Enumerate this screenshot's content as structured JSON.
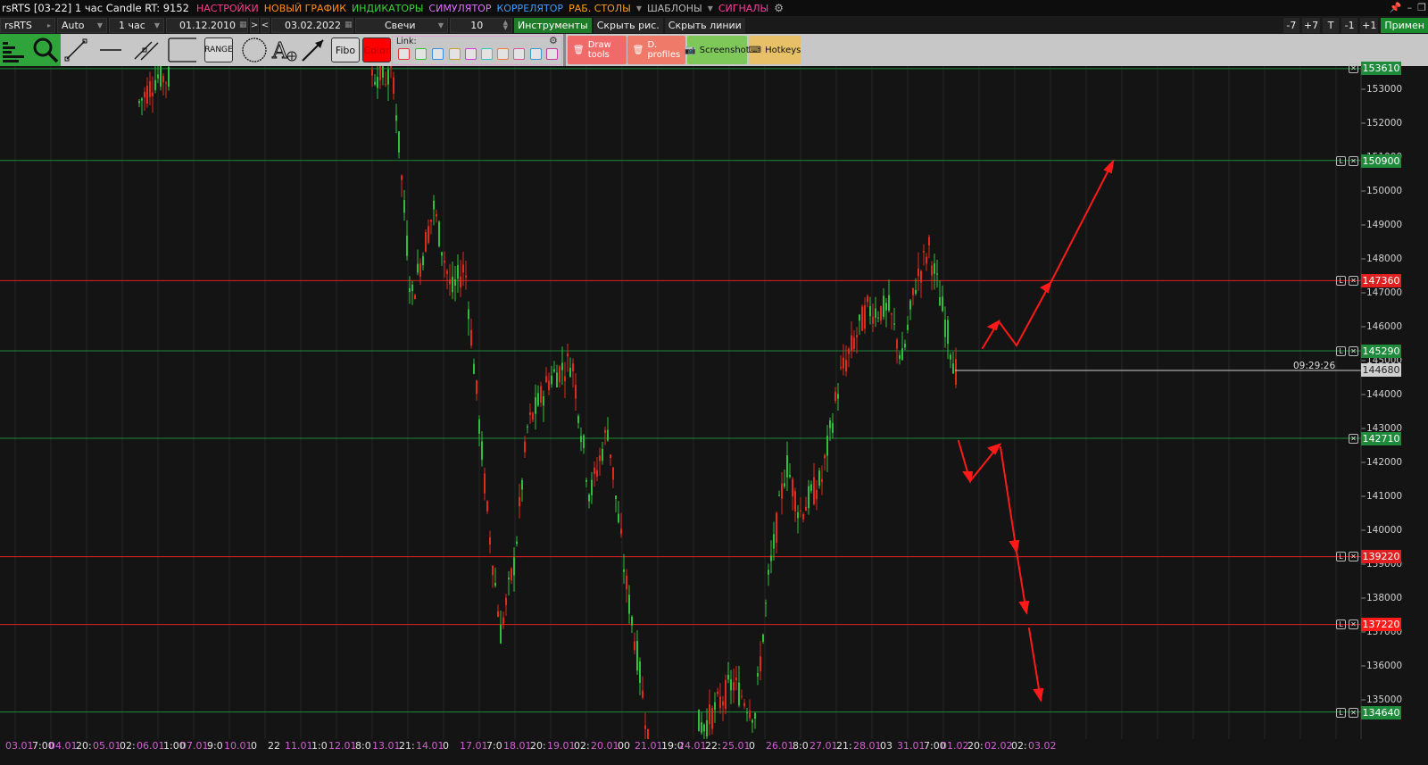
{
  "menu": {
    "title": "rsRTS [03-22] 1 час Candle RT: 9152",
    "items": [
      {
        "label": "НАСТРОЙКИ",
        "color": "#ff3c8c"
      },
      {
        "label": "НОВЫЙ ГРАФИК",
        "color": "#ff8c1a"
      },
      {
        "label": "ИНДИКАТОРЫ",
        "color": "#3cd23c"
      },
      {
        "label": "СИМУЛЯТОР",
        "color": "#e070ff"
      },
      {
        "label": "КОРРЕЛЯТОР",
        "color": "#3c9cff"
      },
      {
        "label": "РАБ. СТОЛЫ",
        "color": "#ff9c1a"
      },
      {
        "label": "ШАБЛОНЫ",
        "color": "#b9b9b9"
      },
      {
        "label": "СИГНАЛЫ",
        "color": "#ff3ca0"
      }
    ]
  },
  "toolbar": {
    "symbol": "rsRTS",
    "mode": "Auto",
    "timeframe": "1 час",
    "date_from": "01.12.2010",
    "nav_next": ">",
    "nav_prev": "<",
    "date_to": "03.02.2022",
    "chart_type": "Свечи",
    "count": "10",
    "instruments": "Инструменты",
    "hide_drawings": "Скрыть рис.",
    "hide_lines": "Скрыть линии",
    "right_buttons": [
      "-7",
      "+7",
      "T",
      "-1",
      "+1"
    ],
    "apply": "Примен"
  },
  "drawbar": {
    "range_label": "RANGE",
    "fibo_label": "Fibo",
    "color_label": "Color",
    "link_label": "Link:",
    "link_colors": [
      "#e23b3b",
      "#39c23c",
      "#3b8fe0",
      "#c89a2f",
      "#d23bd2",
      "#2fc9c9",
      "#f27b3a",
      "#e64da0",
      "#3a9ac9",
      "#c23ba0"
    ],
    "draw_tools": "Draw tools",
    "profiles": "D. profiles",
    "screenshot": "Screenshot",
    "hotkeys": "Hotkeys"
  },
  "price_axis": {
    "ticks": [
      "153000",
      "152000",
      "151000",
      "150000",
      "149000",
      "148000",
      "147000",
      "146000",
      "145000",
      "144000",
      "143000",
      "142000",
      "141000",
      "140000",
      "139000",
      "138000",
      "137000",
      "136000",
      "135000"
    ],
    "current_price": "144680",
    "timer": "09:29:26"
  },
  "levels": [
    {
      "price": "153610",
      "color": "#1e8a3c"
    },
    {
      "price": "150900",
      "color": "#1e8a3c"
    },
    {
      "price": "147360",
      "color": "#e02020"
    },
    {
      "price": "145290",
      "color": "#1e8a3c"
    },
    {
      "price": "142710",
      "color": "#1e8a3c"
    },
    {
      "price": "139220",
      "color": "#e02020"
    },
    {
      "price": "137220",
      "color": "#e02020"
    },
    {
      "price": "134640",
      "color": "#1e8a3c"
    }
  ],
  "time_axis": [
    "03.01",
    "7:00",
    "04.01",
    "20:",
    "05.01",
    "02:",
    "06.01",
    "1:00",
    "07.01",
    "9:0",
    "10.01",
    "0",
    "22",
    "11.01",
    "1:0",
    "12.01",
    "8:0",
    "13.01",
    "21:",
    "14.01",
    "0",
    "17.01",
    "7:0",
    "18.01",
    "20:",
    "19.01",
    "02:",
    "20.01",
    "00",
    "21.01",
    "19:0",
    "24.01",
    "22:",
    "25.01",
    "0",
    "26.01",
    "8:0",
    "27.01",
    "21:",
    "28.01",
    "03",
    "31.01",
    "7:00",
    "01.02",
    "20:",
    "02.02",
    "02:",
    "03.02"
  ]
}
